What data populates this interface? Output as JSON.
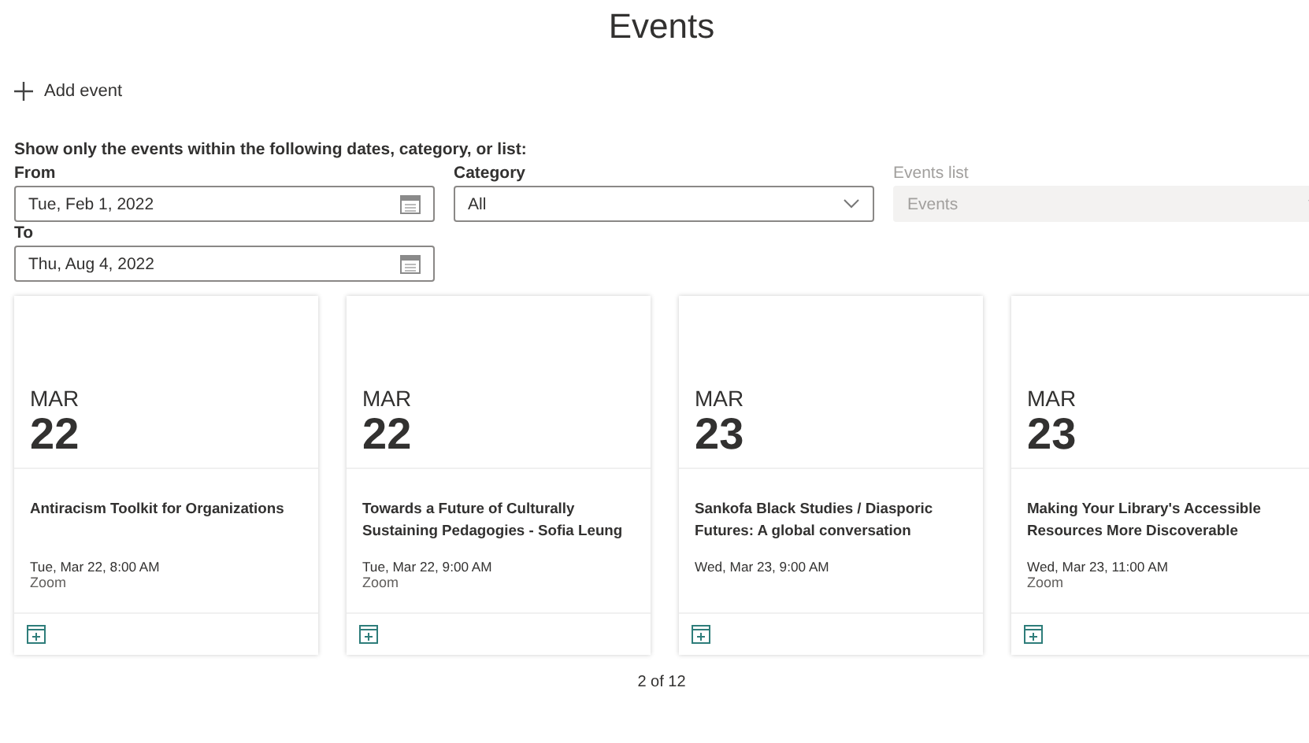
{
  "title": "Events",
  "add_button": {
    "label": "Add event"
  },
  "filters": {
    "heading": "Show only the events within the following dates, category, or list:",
    "from": {
      "label": "From",
      "value": "Tue, Feb 1, 2022"
    },
    "category": {
      "label": "Category",
      "value": "All",
      "disabled": false
    },
    "events_list": {
      "label": "Events list",
      "value": "Events",
      "disabled": true
    },
    "to": {
      "label": "To",
      "value": "Thu, Aug 4, 2022"
    }
  },
  "events": [
    {
      "month": "MAR",
      "day": "22",
      "title": "Antiracism Toolkit for Organizations",
      "when": "Tue, Mar 22, 8:00 AM",
      "location": "Zoom"
    },
    {
      "month": "MAR",
      "day": "22",
      "title": "Towards a Future of Culturally Sustaining Pedagogies - Sofia Leung",
      "when": "Tue, Mar 22, 9:00 AM",
      "location": "Zoom"
    },
    {
      "month": "MAR",
      "day": "23",
      "title": "Sankofa Black Studies / Diasporic Futures: A global conversation",
      "when": "Wed, Mar 23, 9:00 AM"
    },
    {
      "month": "MAR",
      "day": "23",
      "title": "Making Your Library's Accessible Resources More Discoverable",
      "when": "Wed, Mar 23, 11:00 AM",
      "location": "Zoom"
    }
  ],
  "pager": "2 of 12"
}
